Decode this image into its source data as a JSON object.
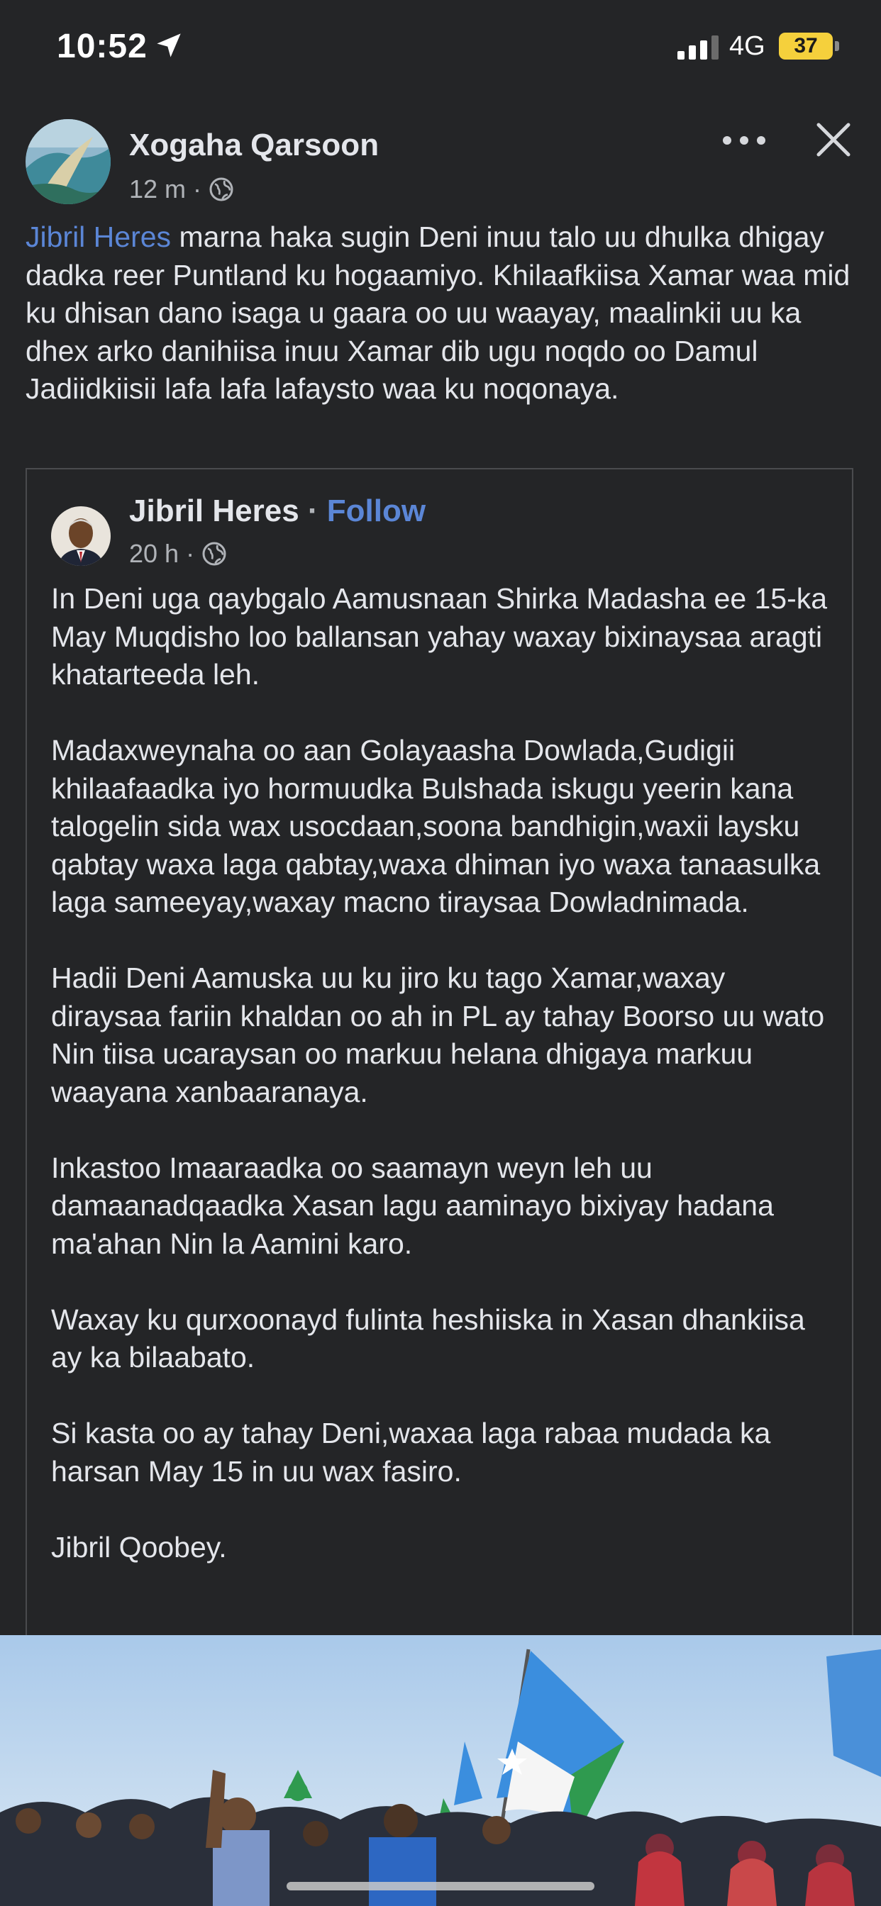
{
  "status_bar": {
    "time": "10:52",
    "network": "4G",
    "battery": "37",
    "icons": [
      "location-arrow-icon",
      "signal-icon",
      "battery-icon"
    ]
  },
  "post": {
    "page_name": "Xogaha Qarsoon",
    "time_ago": "12 m",
    "meta_separator": "·",
    "mention": "Jibril Heres",
    "text_after_mention": " marna haka sugin Deni inuu talo uu dhulka dhigay dadka reer Puntland ku hogaamiyo. Khilaafkiisa Xamar waa mid ku dhisan dano isaga u gaara oo uu waayay, maalinkii uu ka dhex arko danihiisa inuu Xamar dib ugu noqdo oo Damul Jadiidkiisii lafa lafa lafaysto waa ku noqonaya.",
    "icons": [
      "more-icon",
      "close-icon",
      "globe-icon"
    ]
  },
  "shared_post": {
    "author": "Jibril Heres",
    "separator": " · ",
    "follow_label": "Follow",
    "time_ago": "20 h",
    "meta_separator": "·",
    "paragraphs": [
      "In Deni uga qaybgalo Aamusnaan Shirka Madasha ee 15-ka May Muqdisho loo ballansan yahay waxay bixinaysaa aragti khatarteeda leh.",
      "Madaxweynaha oo aan Golayaasha Dowlada,Gudigii khilaafaadka iyo hormuudka Bulshada iskugu yeerin kana talogelin sida wax usocdaan,soona bandhigin,waxii laysku qabtay waxa laga qabtay,waxa dhiman iyo waxa tanaasulka laga sameeyay,waxay macno tiraysaa Dowladnimada.",
      "Hadii Deni Aamuska uu ku jiro ku tago Xamar,waxay diraysaa fariin khaldan oo ah in PL ay tahay Boorso uu wato Nin tiisa ucaraysan oo markuu helana dhigaya markuu waayana xanbaaranaya.",
      "Inkastoo Imaaraadka oo saamayn weyn leh uu damaanadqaadka Xasan lagu aaminayo bixiyay hadana ma'ahan Nin la Aamini karo.",
      "Waxay ku qurxoonayd fulinta heshiiska in Xasan dhankiisa ay ka bilaabato.",
      "Si kasta oo ay tahay Deni,waxaa laga rabaa mudada ka harsan May 15 in uu wax fasiro.",
      "Jibril Qoobey."
    ]
  },
  "colors": {
    "background": "#242527",
    "text": "#e4e6eb",
    "secondary_text": "#b0b3b8",
    "link": "#5b86d6",
    "battery": "#f5d03c"
  }
}
